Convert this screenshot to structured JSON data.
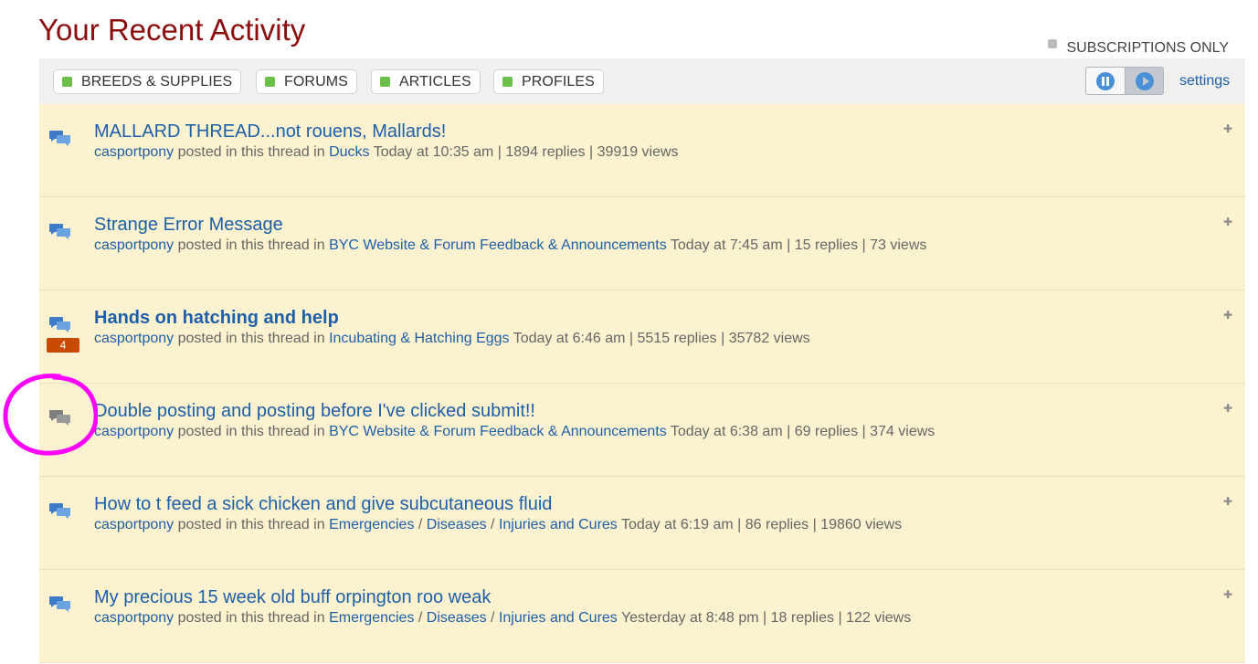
{
  "header": {
    "title": "Your Recent Activity",
    "subscriptions_only": "SUBSCRIPTIONS ONLY"
  },
  "filters": [
    {
      "label": "BREEDS & SUPPLIES"
    },
    {
      "label": "FORUMS"
    },
    {
      "label": "ARTICLES"
    },
    {
      "label": "PROFILES"
    }
  ],
  "settings_label": "settings",
  "colors": {
    "accent": "#1d5fa8",
    "title": "#8b0d0d",
    "row_bg": "#fcf2cf",
    "badge": "#c84900",
    "filter_dot": "#6cc04a",
    "annotation": "#ff00ff"
  },
  "posted_text": "posted in this thread in",
  "items": [
    {
      "title": "MALLARD THREAD...not rouens, Mallards!",
      "bold": false,
      "badge": "",
      "icon": "chat-bubbles-icon",
      "user": "casportpony",
      "categories": [
        "Ducks"
      ],
      "time": "Today at 10:35 am",
      "replies": "1894 replies",
      "views": "39919 views"
    },
    {
      "title": "Strange Error Message",
      "bold": false,
      "badge": "",
      "icon": "chat-bubbles-icon",
      "user": "casportpony",
      "categories": [
        "BYC Website & Forum Feedback & Announcements"
      ],
      "time": "Today at 7:45 am",
      "replies": "15 replies",
      "views": "73 views"
    },
    {
      "title": "Hands on hatching and help",
      "bold": true,
      "badge": "4",
      "icon": "chat-bubbles-icon",
      "user": "casportpony",
      "categories": [
        "Incubating & Hatching Eggs"
      ],
      "time": "Today at 6:46 am",
      "replies": "5515 replies",
      "views": "35782 views"
    },
    {
      "title": "Double posting and posting before I've clicked submit!!",
      "bold": false,
      "badge": "",
      "icon": "chat-bubbles-gray-icon",
      "user": "casportpony",
      "categories": [
        "BYC Website & Forum Feedback & Announcements"
      ],
      "time": "Today at 6:38 am",
      "replies": "69 replies",
      "views": "374 views"
    },
    {
      "title": "How to t feed a sick chicken and give subcutaneous fluid",
      "bold": false,
      "badge": "",
      "icon": "chat-bubbles-icon",
      "user": "casportpony",
      "categories": [
        "Emergencies",
        "Diseases",
        "Injuries and Cures"
      ],
      "time": "Today at 6:19 am",
      "replies": "86 replies",
      "views": "19860 views"
    },
    {
      "title": "My precious 15 week old buff orpington roo weak",
      "bold": false,
      "badge": "",
      "icon": "chat-bubbles-icon",
      "user": "casportpony",
      "categories": [
        "Emergencies",
        "Diseases",
        "Injuries and Cures"
      ],
      "time": "Yesterday at 8:48 pm",
      "replies": "18 replies",
      "views": "122 views"
    }
  ]
}
